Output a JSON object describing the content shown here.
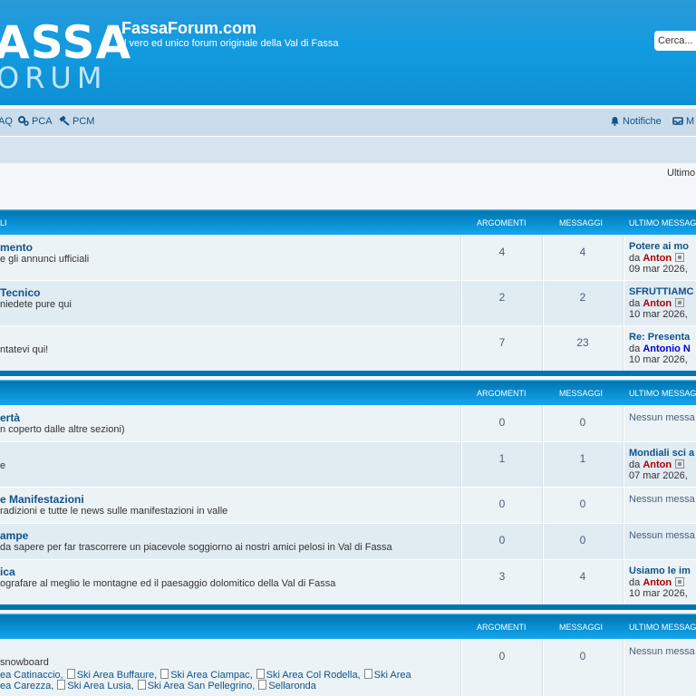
{
  "header": {
    "logo_top": "ASSA",
    "logo_bottom": "ORUM",
    "site_title": "FassaForum.com",
    "site_description": "Il vero ed unico forum originale della Val di Fassa",
    "search_placeholder": "Cerca..."
  },
  "navbar": {
    "faq": "AQ",
    "pca": "PCA",
    "pcm": "PCM",
    "notifications": "Notifiche",
    "messages": "M"
  },
  "last_visit_text": "Ultimo",
  "sections": [
    {
      "header": {
        "title": "LI",
        "topics": "ARGOMENTI",
        "posts": "MESSAGGI",
        "last_post": "ULTIMO MESSAG"
      },
      "forums": [
        {
          "title": "mento",
          "description": "e gli annunci ufficiali",
          "topics": "4",
          "posts": "4",
          "last_title": "Potere ai mo",
          "by": "da",
          "author": "Anton",
          "date": "09 mar 2026,"
        },
        {
          "title": "Tecnico",
          "description": "niedete pure qui",
          "topics": "2",
          "posts": "2",
          "last_title": "SFRUTTIAMC",
          "by": "da",
          "author": "Anton",
          "date": "10 mar 2026,"
        },
        {
          "title": "",
          "description": "ntatevi qui!",
          "topics": "7",
          "posts": "23",
          "last_title": "Re: Presenta",
          "by": "da",
          "author": "Antonio N",
          "date": "10 mar 2026,"
        }
      ]
    },
    {
      "header": {
        "title": "",
        "topics": "ARGOMENTI",
        "posts": "MESSAGGI",
        "last_post": "ULTIMO MESSAG"
      },
      "forums": [
        {
          "title": "ertà",
          "description": "n coperto dalle altre sezioni)",
          "topics": "0",
          "posts": "0",
          "no_posts": "Nessun messa"
        },
        {
          "title": "",
          "description": "e",
          "topics": "1",
          "posts": "1",
          "last_title": "Mondiali sci a",
          "by": "da",
          "author": "Anton",
          "date": "07 mar 2026,"
        },
        {
          "title": "e Manifestazioni",
          "description": "radizioni e tutte le news sulle manifestazioni in valle",
          "topics": "0",
          "posts": "0",
          "no_posts": "Nessun messa"
        },
        {
          "title": "ampe",
          "description": "da sapere per far trascorrere un piacevole soggiorno ai nostri amici pelosi in Val di Fassa",
          "topics": "0",
          "posts": "0",
          "no_posts": "Nessun messa"
        },
        {
          "title": "ica",
          "description": "ografare al meglio le montagne ed il paesaggio dolomitico della Val di Fassa",
          "topics": "3",
          "posts": "4",
          "last_title": "Usiamo le im",
          "by": "da",
          "author": "Anton",
          "date": "10 mar 2026,"
        }
      ]
    },
    {
      "header": {
        "title": "",
        "topics": "ARGOMENTI",
        "posts": "MESSAGGI",
        "last_post": "ULTIMO MESSAG"
      },
      "forums": [
        {
          "title": "",
          "description": "snowboard",
          "topics": "0",
          "posts": "0",
          "no_posts": "Nessun messa",
          "subforums_line1": [
            "ea Catinaccio,",
            "Ski Area Buffaure,",
            "Ski Area Ciampac,",
            "Ski Area Col Rodella,",
            "Ski Area"
          ],
          "subforums_line2": [
            "ea Carezza,",
            "Ski Area Lusia,",
            "Ski Area San Pellegrino,",
            "Sellaronda"
          ]
        }
      ]
    }
  ],
  "colors": {
    "header_blue": "#129be0",
    "link": "#105289",
    "author": "#aa0000",
    "navbar": "#cadceb"
  }
}
